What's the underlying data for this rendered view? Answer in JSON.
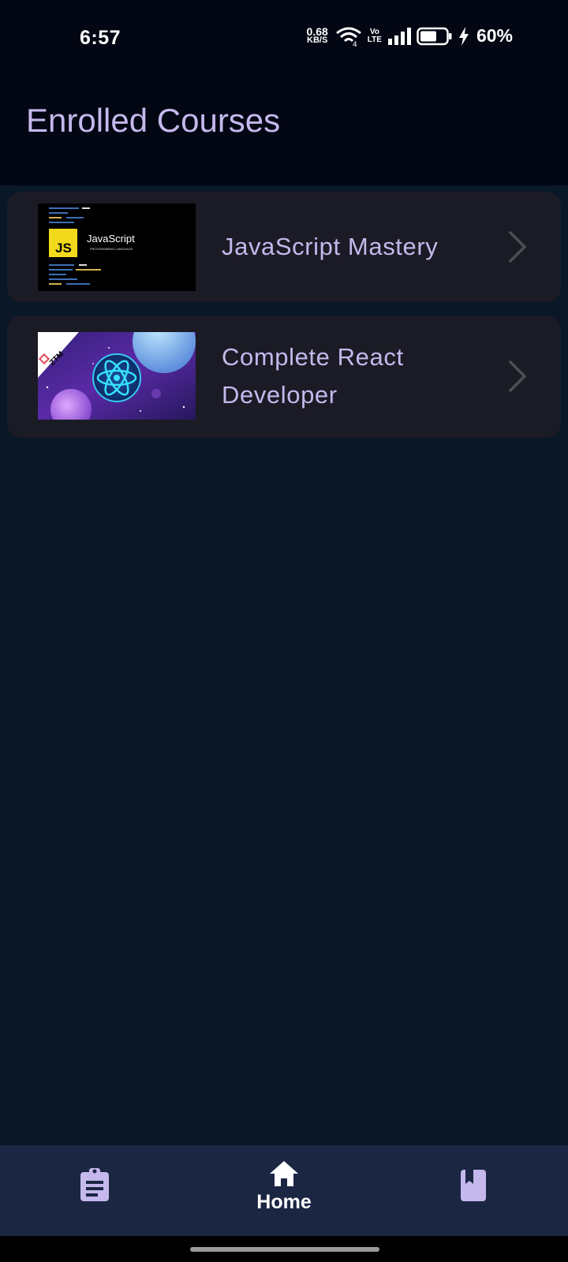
{
  "status_bar": {
    "time": "6:57",
    "net_speed_value": "0.68",
    "net_speed_unit": "KB/S",
    "wifi_tag": "4",
    "volte_top": "Vo",
    "volte_bottom": "LTE",
    "battery_percent": "60%"
  },
  "header": {
    "title": "Enrolled Courses"
  },
  "courses": [
    {
      "title": "JavaScript Mastery",
      "thumb_title": "JavaScript",
      "thumb_subtitle": "PROGRAMMING LANGUAGE",
      "thumb_badge": "JS"
    },
    {
      "title": "Complete React Developer",
      "thumb_badge": "ZTM"
    }
  ],
  "bottom_nav": {
    "items": [
      {
        "icon": "assignment-icon"
      },
      {
        "icon": "home-icon",
        "label": "Home"
      },
      {
        "icon": "bookmark-book-icon"
      }
    ]
  },
  "colors": {
    "background": "#091726",
    "header_bg": "#030613",
    "card_bg": "#1b1b26",
    "accent": "#c4b8ec",
    "nav_bg": "#1b2643"
  }
}
